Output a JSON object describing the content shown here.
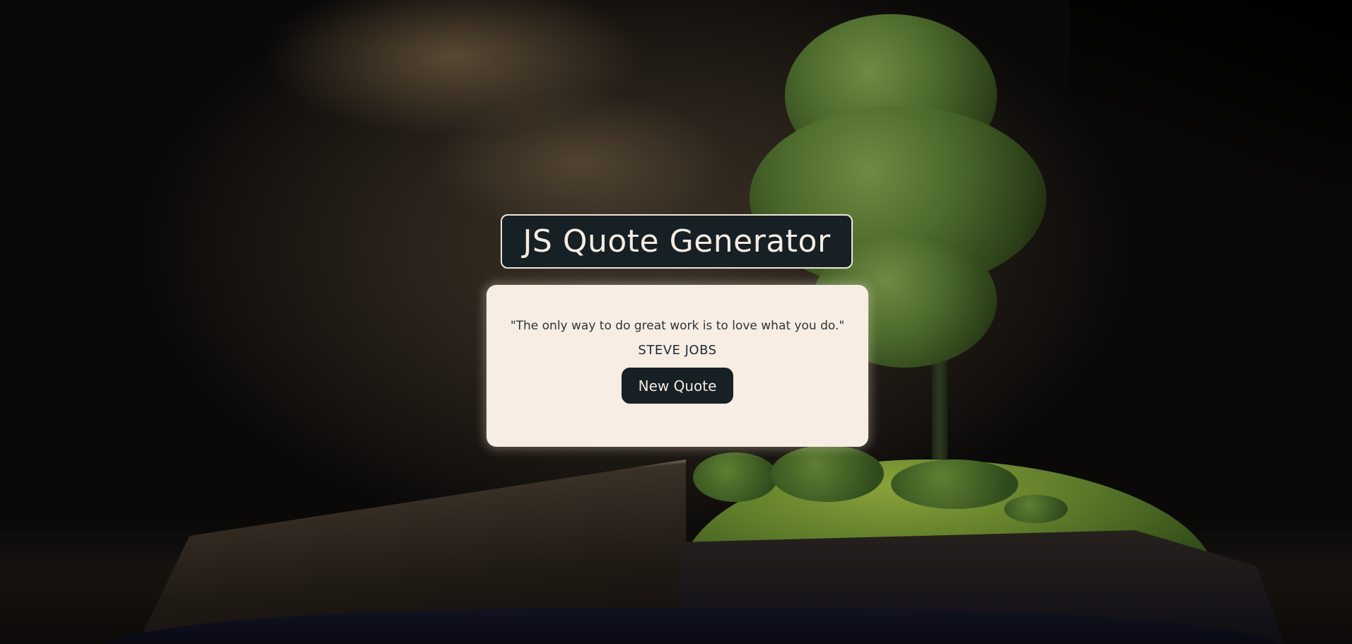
{
  "header": {
    "title": "JS Quote Generator"
  },
  "quote": {
    "text": "\"The only way to do great work is to love what you do.\"",
    "author": "STEVE JOBS"
  },
  "actions": {
    "new_quote_label": "New Quote"
  },
  "colors": {
    "panel_dark": "#172024",
    "card_bg": "#f7ede3",
    "title_text": "#f4ece2",
    "author_text": "#1d2a3a"
  }
}
